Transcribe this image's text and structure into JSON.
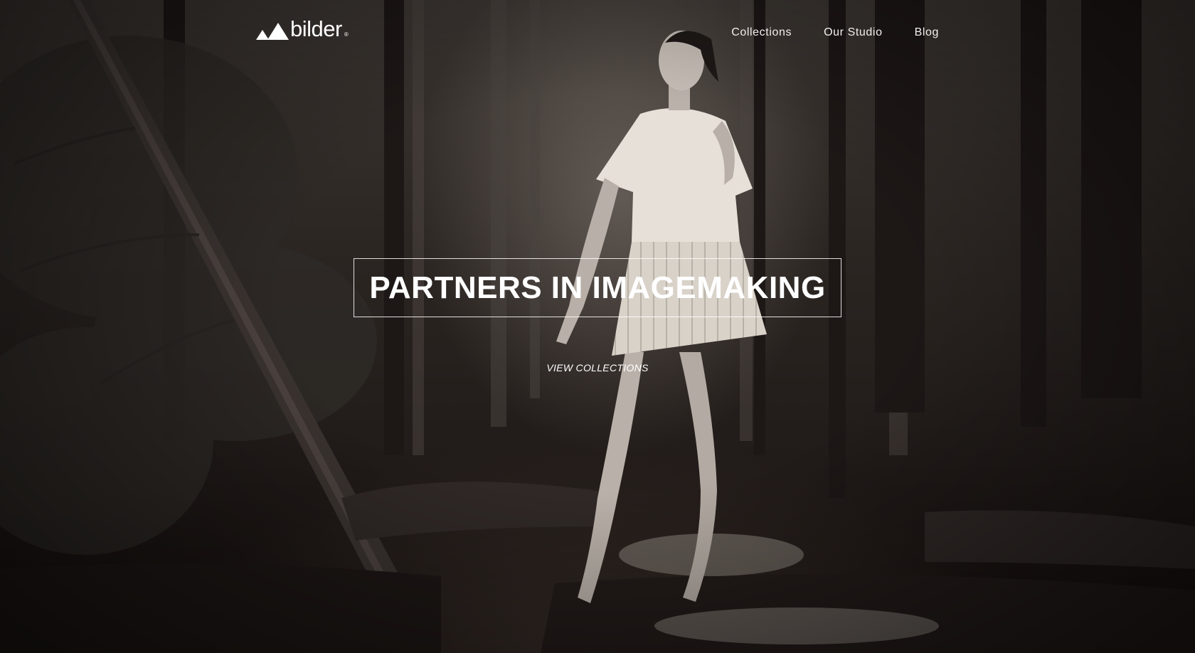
{
  "brand": {
    "name": "bilder",
    "registered_mark": "®",
    "logo_icon": "double-triangle-logo-icon"
  },
  "nav": {
    "items": [
      {
        "label": "Collections"
      },
      {
        "label": "Our Studio"
      },
      {
        "label": "Blog"
      }
    ]
  },
  "hero": {
    "headline": "PARTNERS IN IMAGEMAKING",
    "cta_label": "VIEW COLLECTIONS",
    "background_image": "forest-portrait-photo"
  },
  "colors": {
    "text": "#ffffff",
    "background": "#1a1513"
  }
}
